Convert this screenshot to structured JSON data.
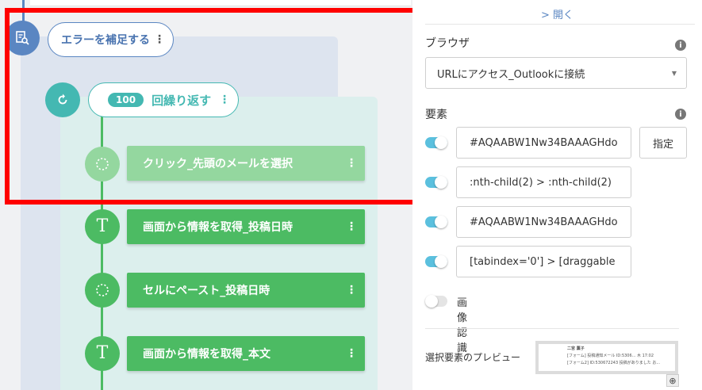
{
  "flow": {
    "try_block": {
      "label": "エラーを補足する"
    },
    "loop_block": {
      "count": "100",
      "label": "回繰り返す"
    },
    "steps": [
      {
        "label": "クリック_先頭のメールを選択",
        "icon": "click-icon",
        "dimmed": true
      },
      {
        "label": "画面から情報を取得_投稿日時",
        "icon": "text-icon"
      },
      {
        "label": "セルにペースト_投稿日時",
        "icon": "paste-icon"
      },
      {
        "label": "画面から情報を取得_本文",
        "icon": "text-icon"
      }
    ],
    "menu_glyph": "⋮",
    "text_icon_glyph": "T"
  },
  "panel": {
    "open_label": "> 開く",
    "browser": {
      "label": "ブラウザ",
      "value": "URLにアクセス_Outlookに接続"
    },
    "elements": {
      "label": "要素",
      "selectors": [
        {
          "value": "#AQAABW1Nw34BAAAGHdo",
          "enabled": true
        },
        {
          "value": ":nth-child(2) > :nth-child(2)",
          "enabled": true
        },
        {
          "value": "#AQAABW1Nw34BAAAGHdo",
          "enabled": true
        },
        {
          "value": "[tabindex='0'] > [draggable",
          "enabled": true
        }
      ],
      "assign_button": "指定",
      "image_recognition": {
        "label": "画像認識",
        "enabled": false
      }
    },
    "preview": {
      "label": "選択要素のプレビュー",
      "thumbnail_lines": [
        "二宮 薫子",
        "[フォーム] 投稿通知メール ID:5306...   木 17:02",
        "[フォーム2] ID:530672243 投稿がありました お..."
      ]
    }
  },
  "colors": {
    "try_blue": "#5a86c2",
    "loop_teal": "#44b8b2",
    "step_green": "#4cbb63",
    "step_dim_green": "#94d79f",
    "highlight_red": "#ff0000",
    "toggle_on": "#5bc0de"
  }
}
